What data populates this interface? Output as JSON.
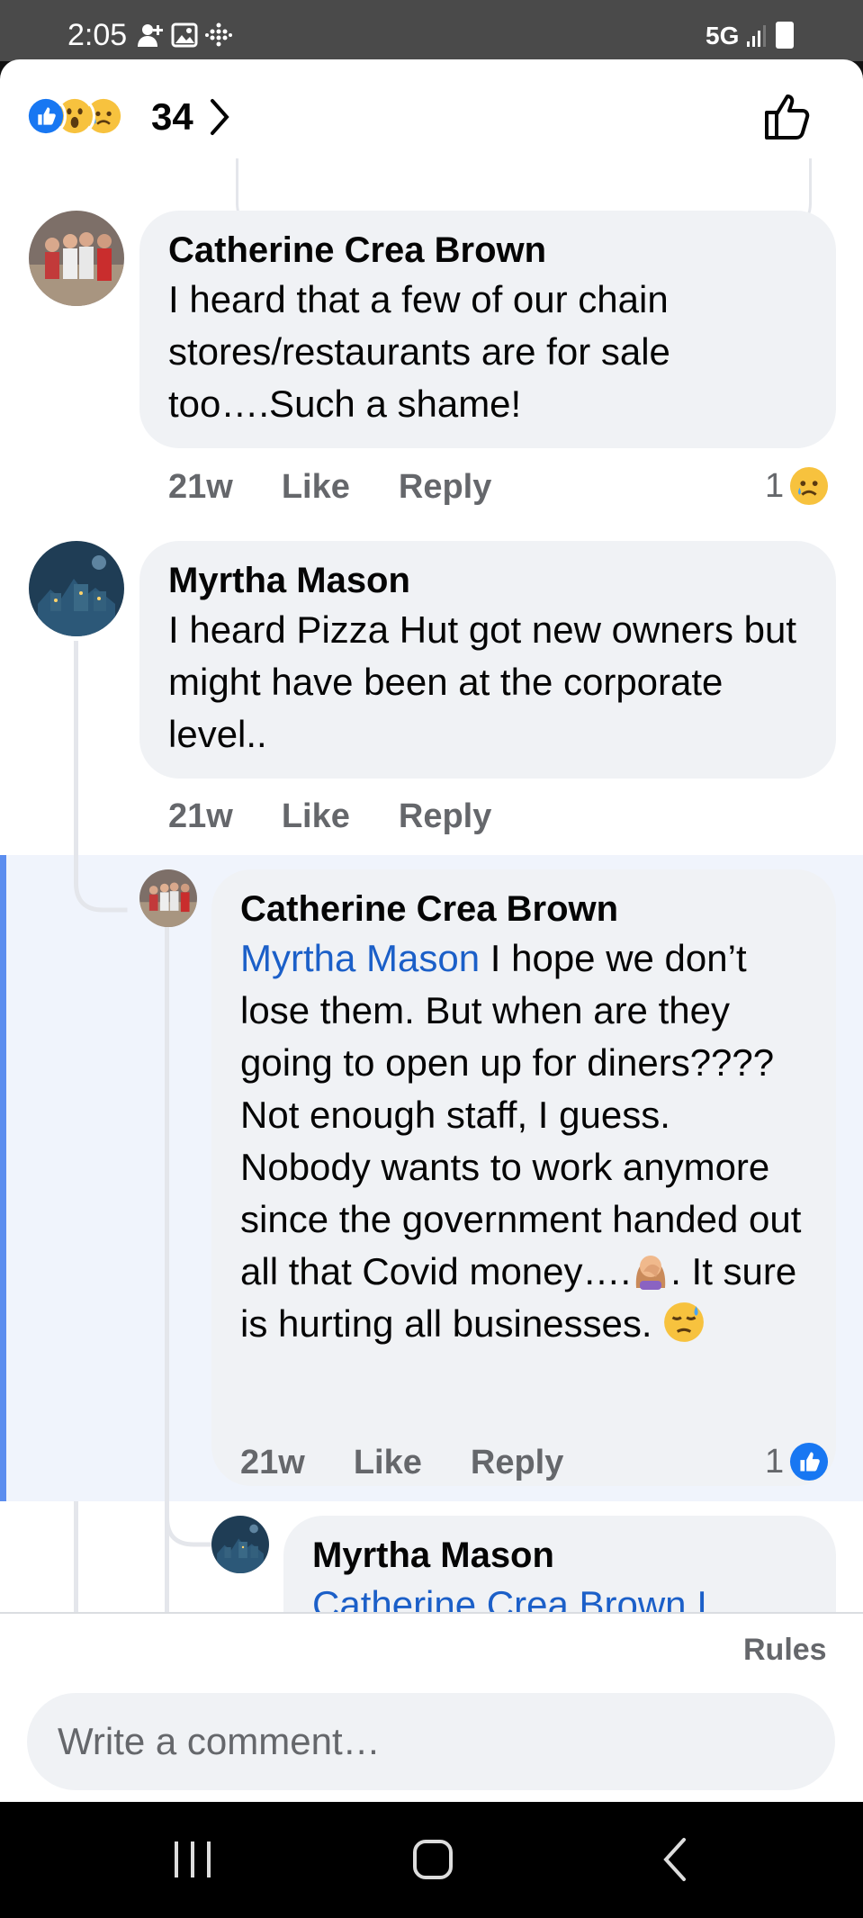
{
  "status_bar": {
    "time": "2:05",
    "network": "5G",
    "left_icons": [
      "person-add-icon",
      "image-icon",
      "grid-dots-icon"
    ]
  },
  "reactions": {
    "count": "34",
    "icons": [
      "like-reaction-icon",
      "wow-reaction-icon",
      "sad-reaction-icon"
    ]
  },
  "comments": [
    {
      "author": "Catherine Crea Brown",
      "text": "I heard that a few of our chain stores/restaurants are for sale too….Such a shame!",
      "age": "21w",
      "like_label": "Like",
      "reply_label": "Reply",
      "reaction_count": "1",
      "reaction_icon": "sad-reaction-icon"
    },
    {
      "author": "Myrtha Mason",
      "text": "I heard Pizza Hut got new owners but might have been at the corporate level..",
      "age": "21w",
      "like_label": "Like",
      "reply_label": "Reply"
    },
    {
      "author": "Catherine Crea Brown",
      "mention": "Myrtha Mason",
      "text_a": " I hope we don’t lose them.  But when are they going to open up for diners????  Not enough staff, I guess.  Nobody wants to work anymore since the government handed out all that Covid money….",
      "text_b": ".  It sure is hurting all businesses.  ",
      "emoji_a": "facepalm-emoji",
      "emoji_b": "downcast-sweat-emoji",
      "age": "21w",
      "like_label": "Like",
      "reply_label": "Reply",
      "reaction_count": "1",
      "reaction_icon": "like-reaction-icon"
    },
    {
      "author": "Myrtha Mason",
      "mention_partial": "Catherine Crea Brown I"
    }
  ],
  "footer": {
    "rules_label": "Rules",
    "composer_placeholder": "Write a comment…"
  },
  "colors": {
    "like_blue": "#1877f2",
    "mention_blue": "#1b5fc8",
    "highlight_bar": "#5b8def",
    "bubble_bg": "#f0f2f5",
    "meta_gray": "#65676b"
  }
}
